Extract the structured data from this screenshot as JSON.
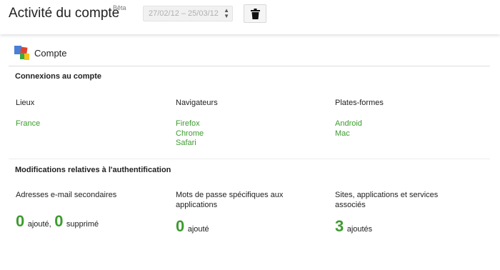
{
  "header": {
    "title": "Activité du compte",
    "badge": "Bêta",
    "date_range": "27/02/12 – 25/03/12",
    "delete_icon": "trash-icon"
  },
  "section": {
    "icon": "google-logo",
    "title": "Compte"
  },
  "connections": {
    "title": "Connexions au compte",
    "columns": [
      {
        "label": "Lieux",
        "items": [
          "France"
        ]
      },
      {
        "label": "Navigateurs",
        "items": [
          "Firefox",
          "Chrome",
          "Safari"
        ]
      },
      {
        "label": "Plates-formes",
        "items": [
          "Android",
          "Mac"
        ]
      }
    ]
  },
  "auth": {
    "title": "Modifications relatives à l'authentification",
    "columns": [
      {
        "label": "Adresses e-mail secondaires",
        "num1": "0",
        "unit1": "ajouté,",
        "num2": "0",
        "unit2": "supprimé"
      },
      {
        "label": "Mots de passe spécifiques aux applications",
        "num1": "0",
        "unit1": "ajouté"
      },
      {
        "label": "Sites, applications et services associés",
        "num1": "3",
        "unit1": "ajoutés"
      }
    ]
  },
  "colors": {
    "link": "#3d9b2f",
    "text": "#222222",
    "muted": "#b0b0b0"
  }
}
